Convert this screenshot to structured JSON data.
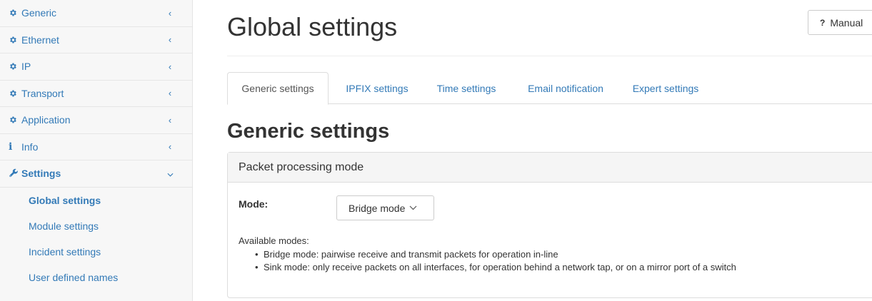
{
  "sidebar": {
    "items": [
      {
        "label": "Generic",
        "icon": "gear-icon",
        "chevron": "‹"
      },
      {
        "label": "Ethernet",
        "icon": "gear-icon",
        "chevron": "‹"
      },
      {
        "label": "IP",
        "icon": "gear-icon",
        "chevron": "‹"
      },
      {
        "label": "Transport",
        "icon": "gear-icon",
        "chevron": "‹"
      },
      {
        "label": "Application",
        "icon": "gear-icon",
        "chevron": "‹"
      },
      {
        "label": "Info",
        "icon": "info-icon",
        "icon_glyph": "i",
        "chevron": "‹"
      },
      {
        "label": "Settings",
        "icon": "wrench-icon",
        "chevron": "⌄"
      }
    ],
    "subitems": [
      {
        "label": "Global settings"
      },
      {
        "label": "Module settings"
      },
      {
        "label": "Incident settings"
      },
      {
        "label": "User defined names"
      }
    ]
  },
  "header": {
    "title": "Global settings",
    "manual_icon": "?",
    "manual_label": "Manual"
  },
  "tabs": [
    {
      "label": "Generic settings"
    },
    {
      "label": "IPFIX settings"
    },
    {
      "label": "Time settings"
    },
    {
      "label": "Email notification"
    },
    {
      "label": "Expert settings"
    }
  ],
  "section": {
    "title": "Generic settings",
    "panel_title": "Packet processing mode",
    "mode_label": "Mode:",
    "mode_value": "Bridge mode",
    "available_label": "Available modes:",
    "modes": [
      "Bridge mode: pairwise receive and transmit packets for operation in-line",
      "Sink mode: only receive packets on all interfaces, for operation behind a network tap, or on a mirror port of a switch"
    ]
  },
  "colors": {
    "link": "#337ab7",
    "text": "#333333",
    "sidebar_bg": "#f7f7f7",
    "panel_heading_bg": "#f5f5f5",
    "border": "#dddddd"
  }
}
